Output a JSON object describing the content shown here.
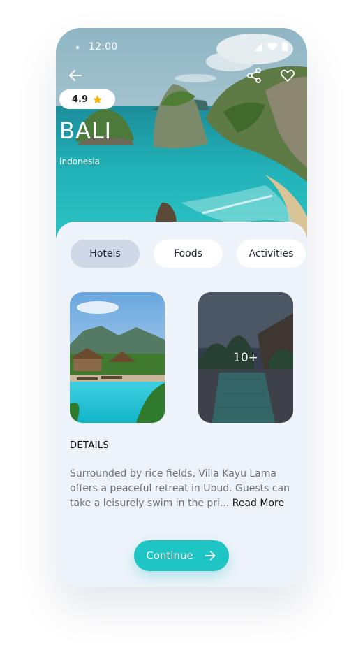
{
  "status_bar": {
    "time": "12:00"
  },
  "header": {
    "back_icon": "arrow-left-icon",
    "share_icon": "share-icon",
    "favorite_icon": "heart-outline-icon"
  },
  "place": {
    "rating": "4.9",
    "rating_icon": "star-icon",
    "title": "BALI",
    "country": "Indonesia"
  },
  "tabs": [
    {
      "label": "Hotels",
      "active": true
    },
    {
      "label": "Foods",
      "active": false
    },
    {
      "label": "Activities",
      "active": false
    }
  ],
  "gallery": {
    "more_count": "10+"
  },
  "details": {
    "title": "DETAILS",
    "text": "Surrounded by rice fields, Villa Kayu Lama offers a peaceful retreat in Ubud. Guests can take a leisurely swim in the pri...",
    "read_more": "Read More"
  },
  "cta": {
    "label": "Continue",
    "icon": "arrow-right-icon"
  },
  "colors": {
    "accent": "#1fc4c4",
    "active_tab": "#cfd8e6",
    "sheet_bg": "#eef3fa"
  }
}
